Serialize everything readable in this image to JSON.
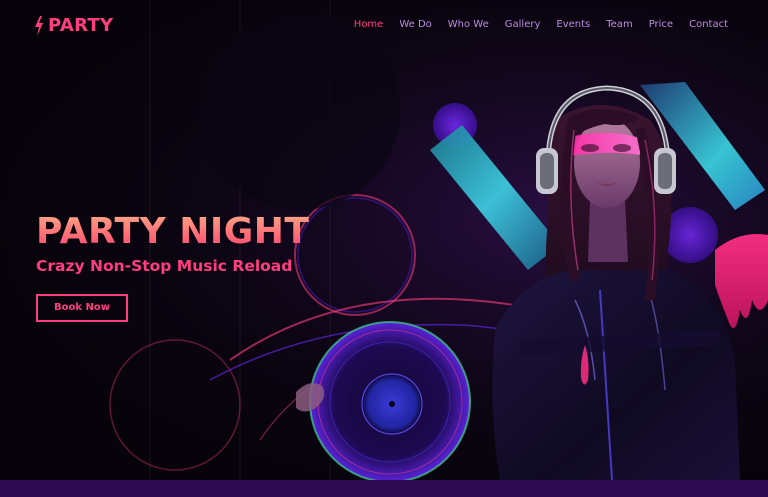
{
  "brand": {
    "name": "PARTY",
    "icon": "lightning-bolt-icon",
    "color": "#ff3d7f"
  },
  "nav": {
    "items": [
      {
        "label": "Home",
        "active": true
      },
      {
        "label": "We Do",
        "active": false
      },
      {
        "label": "Who We",
        "active": false
      },
      {
        "label": "Gallery",
        "active": false
      },
      {
        "label": "Events",
        "active": false
      },
      {
        "label": "Team",
        "active": false
      },
      {
        "label": "Price",
        "active": false
      },
      {
        "label": "Contact",
        "active": false
      }
    ]
  },
  "hero": {
    "title": "PARTY NIGHT",
    "subtitle": "Crazy Non-Stop Music Reload",
    "cta_label": "Book Now"
  },
  "colors": {
    "accent": "#ff3d7f",
    "nav_text": "#b98de0",
    "background": "#07030b",
    "bottom_bar": "#2b0a4f"
  }
}
